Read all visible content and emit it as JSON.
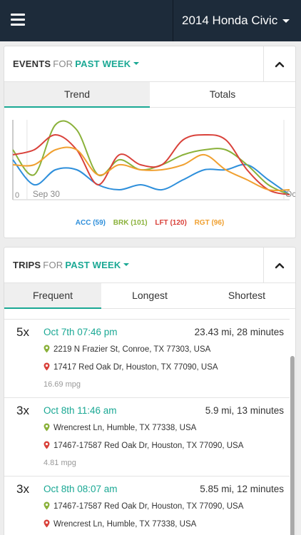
{
  "topbar": {
    "vehicle": "2014 Honda Civic"
  },
  "events": {
    "title": "EVENTS",
    "for": "FOR",
    "range": "PAST WEEK",
    "tabs": [
      {
        "label": "Trend",
        "active": true
      },
      {
        "label": "Totals",
        "active": false
      }
    ]
  },
  "chart_data": {
    "type": "line",
    "xticks": [
      "Sep 30",
      "Oct"
    ],
    "yticks": [
      "0"
    ],
    "x": [
      0,
      1,
      2,
      3,
      4,
      5,
      6,
      7,
      8,
      9,
      10,
      11,
      12,
      13
    ],
    "series": [
      {
        "name": "ACC (59)",
        "color": "#2e8fdb",
        "values": [
          8,
          3,
          6,
          6,
          3,
          2,
          3,
          2,
          4,
          6,
          6,
          7,
          4,
          1
        ]
      },
      {
        "name": "BRK (101)",
        "color": "#8ab13a",
        "values": [
          10,
          5,
          15,
          14,
          5,
          8,
          6,
          7,
          9,
          10,
          10,
          7,
          3,
          1
        ]
      },
      {
        "name": "LFT (120)",
        "color": "#d9413a",
        "values": [
          9,
          10,
          13,
          10,
          3,
          9,
          7,
          7,
          12,
          13,
          12,
          6,
          2,
          1
        ]
      },
      {
        "name": "RGT (96)",
        "color": "#f0a030",
        "values": [
          7,
          7,
          10,
          10,
          5,
          7,
          6,
          6,
          7,
          9,
          6,
          4,
          2,
          2
        ]
      }
    ]
  },
  "trips": {
    "title": "TRIPS",
    "for": "FOR",
    "range": "PAST WEEK",
    "tabs": [
      {
        "label": "Frequent",
        "active": true
      },
      {
        "label": "Longest",
        "active": false
      },
      {
        "label": "Shortest",
        "active": false
      }
    ],
    "items": [
      {
        "count": "5x",
        "when": "Oct 7th 07:46 pm",
        "dist": "23.43 mi, 28 minutes",
        "from": "2219 N Frazier St, Conroe, TX 77303, USA",
        "to": "17417 Red Oak Dr, Houston, TX 77090, USA",
        "mpg": "16.69 mpg"
      },
      {
        "count": "3x",
        "when": "Oct 8th 11:46 am",
        "dist": "5.9 mi, 13 minutes",
        "from": "Wrencrest Ln, Humble, TX 77338, USA",
        "to": "17467-17587 Red Oak Dr, Houston, TX 77090, USA",
        "mpg": "4.81 mpg"
      },
      {
        "count": "3x",
        "when": "Oct 8th 08:07 am",
        "dist": "5.85 mi, 12 minutes",
        "from": "17467-17587 Red Oak Dr, Houston, TX 77090, USA",
        "to": "Wrencrest Ln, Humble, TX 77338, USA",
        "mpg": ""
      }
    ]
  },
  "colors": {
    "accent": "#1aa894",
    "topbar": "#1d2b3a",
    "pin_origin": "#8ab13a",
    "pin_destination": "#d9413a"
  }
}
